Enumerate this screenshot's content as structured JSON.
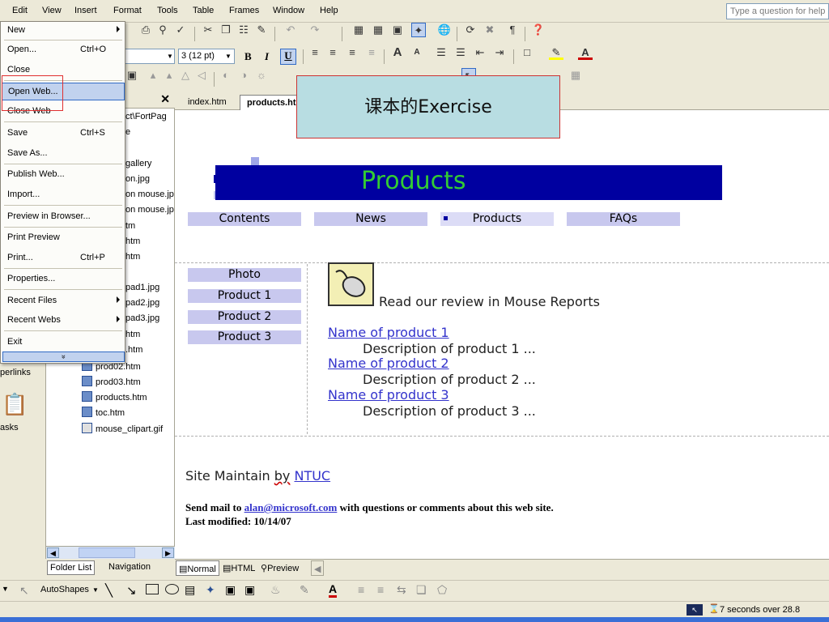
{
  "menubar": {
    "items": [
      "Edit",
      "View",
      "Insert",
      "Format",
      "Tools",
      "Table",
      "Frames",
      "Window",
      "Help"
    ],
    "ask_placeholder": "Type a question for help"
  },
  "toolbar": {
    "font_size": "3 (12 pt)",
    "bold": "B",
    "italic": "I",
    "underline": "U",
    "text_dir": "Aˇ",
    "paragraph": "¶"
  },
  "file_menu": {
    "items": [
      {
        "label": "New",
        "shortcut": "",
        "submenu": true
      },
      {
        "label": "Open...",
        "shortcut": "Ctrl+O",
        "submenu": false
      },
      {
        "label": "Close",
        "shortcut": "",
        "submenu": false
      },
      {
        "label": "Open Web...",
        "shortcut": "",
        "submenu": false
      },
      {
        "label": "Close Web",
        "shortcut": "",
        "submenu": false
      },
      {
        "label": "Save",
        "shortcut": "Ctrl+S",
        "submenu": false
      },
      {
        "label": "Save As...",
        "shortcut": "",
        "submenu": false
      },
      {
        "label": "Publish Web...",
        "shortcut": "",
        "submenu": false
      },
      {
        "label": "Import...",
        "shortcut": "",
        "submenu": false
      },
      {
        "label": "Preview in Browser...",
        "shortcut": "",
        "submenu": false
      },
      {
        "label": "Print Preview",
        "shortcut": "",
        "submenu": false
      },
      {
        "label": "Print...",
        "shortcut": "Ctrl+P",
        "submenu": false
      },
      {
        "label": "Properties...",
        "shortcut": "",
        "submenu": false
      },
      {
        "label": "Recent Files",
        "shortcut": "",
        "submenu": true
      },
      {
        "label": "Recent Webs",
        "shortcut": "",
        "submenu": true
      },
      {
        "label": "Exit",
        "shortcut": "",
        "submenu": false
      }
    ],
    "expand": "»"
  },
  "folder_list": {
    "partial_items": [
      "ct\\FortPag",
      "e",
      "gallery",
      "on.jpg",
      "on mouse.jp",
      "on mouse.jp",
      "tm",
      "htm",
      "htm",
      "",
      "pad1.jpg",
      "pad2.jpg",
      "pad3.jpg",
      "htm",
      ".htm"
    ],
    "files": [
      "prod02.htm",
      "prod03.htm",
      "products.htm",
      "toc.htm",
      "mouse_clipart.gif"
    ],
    "tabs": [
      "Folder List",
      "Navigation"
    ]
  },
  "views_bar": {
    "labels": [
      "perlinks",
      "asks"
    ]
  },
  "doc_tabs": [
    "index.htm",
    "products.htm"
  ],
  "callout": "课本的Exercise",
  "page": {
    "banner": "Products",
    "nav": [
      "Contents",
      "News",
      "Products",
      "FAQs"
    ],
    "side": [
      "Photo",
      "Product 1",
      "Product 2",
      "Product 3"
    ],
    "review": "Read our review in Mouse Reports",
    "products": [
      {
        "name": "Name of product 1",
        "desc": "Description of product 1 ..."
      },
      {
        "name": "Name of product 2",
        "desc": "Description of product 2 ..."
      },
      {
        "name": "Name of product 3",
        "desc": "Description of product 3 ..."
      }
    ],
    "maintain_prefix": "Site Maintain ",
    "maintain_by": "by",
    "maintain_link": "NTUC",
    "mail_prefix": "Send mail to ",
    "mail_link": "alan@microsoft.com",
    "mail_suffix": " with questions or comments about this web site.",
    "modified": "Last modified: 10/14/07"
  },
  "view_tabs": [
    "Normal",
    "HTML",
    "Preview"
  ],
  "drawbar": {
    "autoshapes": "AutoShapes"
  },
  "status": {
    "time": "7 seconds over 28.8"
  }
}
